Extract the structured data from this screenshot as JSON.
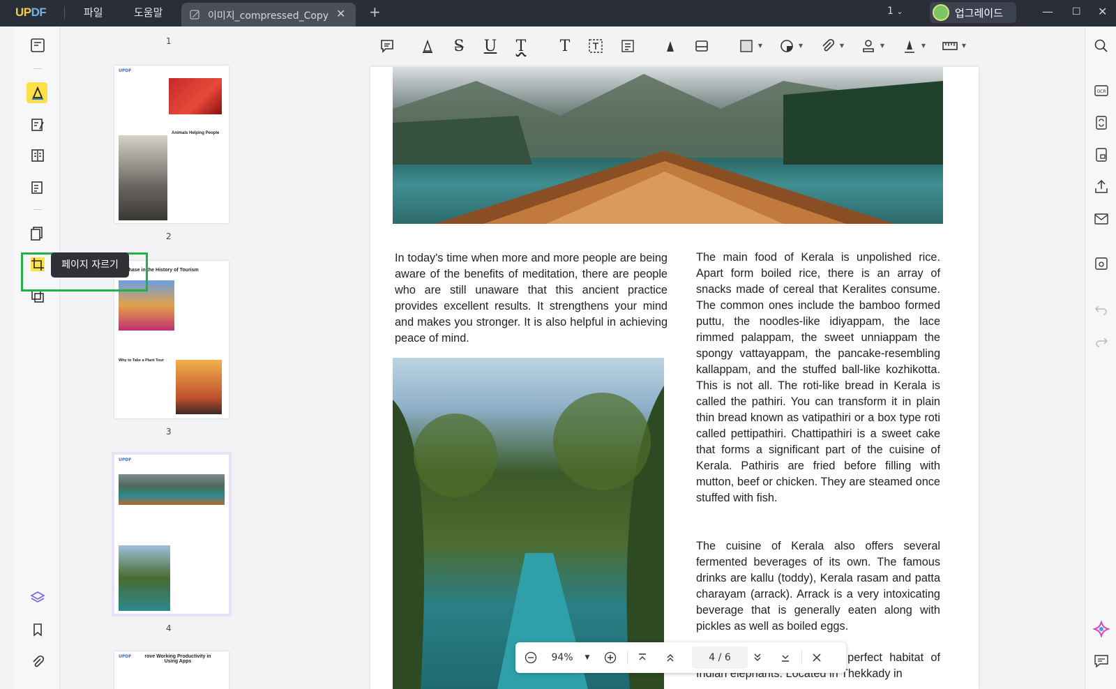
{
  "app": {
    "name": "UPDF"
  },
  "menu": {
    "file": "파일",
    "help": "도움말"
  },
  "tab": {
    "title": "이미지_compressed_Copy"
  },
  "titlebar": {
    "page_selector": "1",
    "upgrade": "업그레이드"
  },
  "tooltip": {
    "crop_pages": "페이지 자르기"
  },
  "thumbnails": [
    {
      "number": "1"
    },
    {
      "number": "2",
      "heading": "Animals Helping People"
    },
    {
      "number": "3",
      "heading": "y Phase in the History of Tourism",
      "subheading": "Why to Take a Plant Tour"
    },
    {
      "number": "4"
    },
    {
      "heading": "rove Working Productivity in Using Apps"
    }
  ],
  "document": {
    "para_left": "In today's time when more and more people are being aware of the benefits of meditation, there are people who are still unaware that this ancient practice provides excellent results. It strengthens your mind and makes you stronger. It is also helpful in achieving peace of mind.",
    "para_right1": "The main food of Kerala is unpolished rice. Apart form boiled rice, there is an array of snacks made of cereal that Keralites consume. The common ones include the bamboo formed puttu, the noodles-like idiyappam, the lace rimmed palappam, the sweet unniappam the spongy vattayappam, the pancake-resembling kallappam, and the stuffed ball-like kozhikotta. This is not all. The roti-like bread in Kerala is called the pathiri. You can transform it in plain thin bread known as vatipathiri or a box type roti called pettipathiri. Chattipathiri is a sweet cake that forms a significant part of the cuisine of Kerala. Pathiris are fried before filling with mutton, beef or chicken. They are steamed once stuffed with fish.",
    "para_right2": "The cuisine of Kerala also offers several fermented beverages of its own. The famous drinks are kallu (toddy), Kerala rasam and patta charayam (arrack). Arrack is a very intoxicating beverage that is generally eaten along with pickles as well as boiled eggs.",
    "para_right3": "Periyar National Park is a perfect habitat of Indian elephants. Located in Thekkady in"
  },
  "zoombar": {
    "zoom": "94%",
    "current_page": "4",
    "page_sep": "/",
    "total_pages": "6"
  },
  "colors": {
    "titlebar": "#2a2e37",
    "accent_yellow": "#fde046",
    "highlight_green": "#22b04a"
  }
}
